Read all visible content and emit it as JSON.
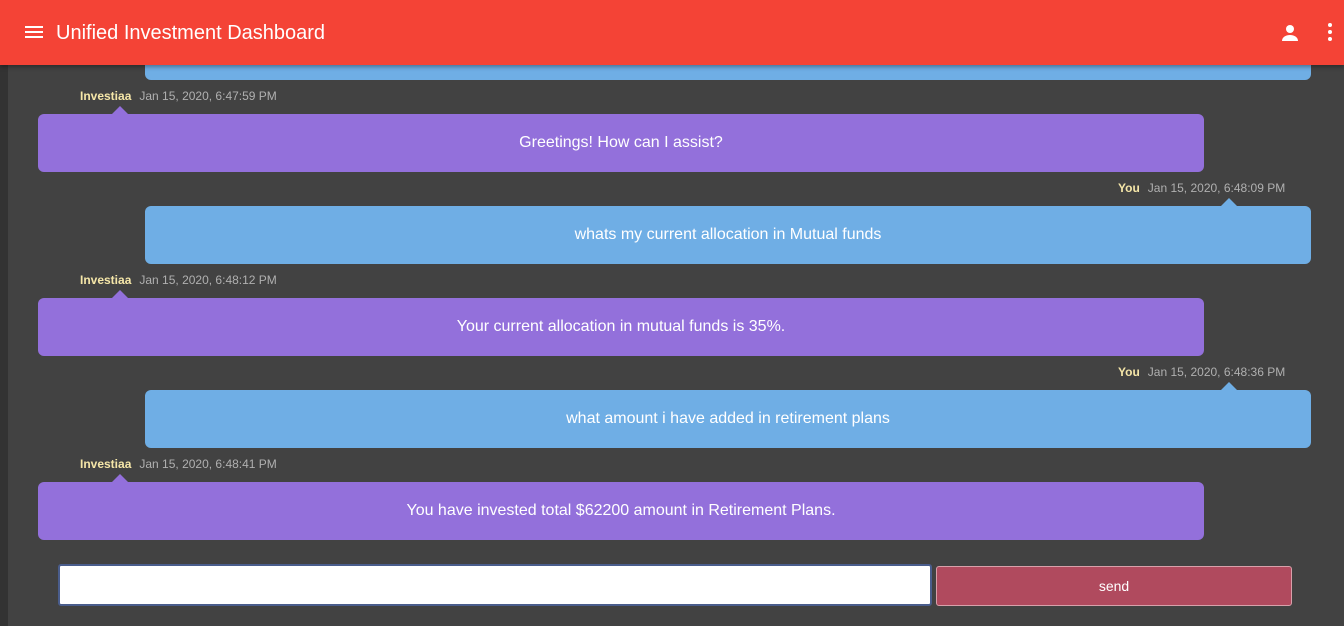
{
  "header": {
    "title": "Unified Investment Dashboard",
    "menu_icon": "hamburger-menu-icon",
    "account_icon": "account-icon",
    "more_icon": "more-vert-icon",
    "background": "#f44336"
  },
  "colors": {
    "bot_bubble": "#9370db",
    "user_bubble": "#6faee5",
    "chat_background": "#424242",
    "send_button": "#b04a5e"
  },
  "messages": [
    {
      "sender": "Investiaa",
      "time": "Jan 15, 2020, 6:47:59 PM",
      "text": "Greetings! How can I assist?"
    },
    {
      "sender": "You",
      "time": "Jan 15, 2020, 6:48:09 PM",
      "text": "whats my current allocation in Mutual funds"
    },
    {
      "sender": "Investiaa",
      "time": "Jan 15, 2020, 6:48:12 PM",
      "text": "Your current allocation in mutual funds is 35%."
    },
    {
      "sender": "You",
      "time": "Jan 15, 2020, 6:48:36 PM",
      "text": "what amount i have added in retirement plans"
    },
    {
      "sender": "Investiaa",
      "time": "Jan 15, 2020, 6:48:41 PM",
      "text": "You have invested total $62200 amount in Retirement Plans."
    }
  ],
  "composer": {
    "input_value": "",
    "send_label": "send"
  }
}
